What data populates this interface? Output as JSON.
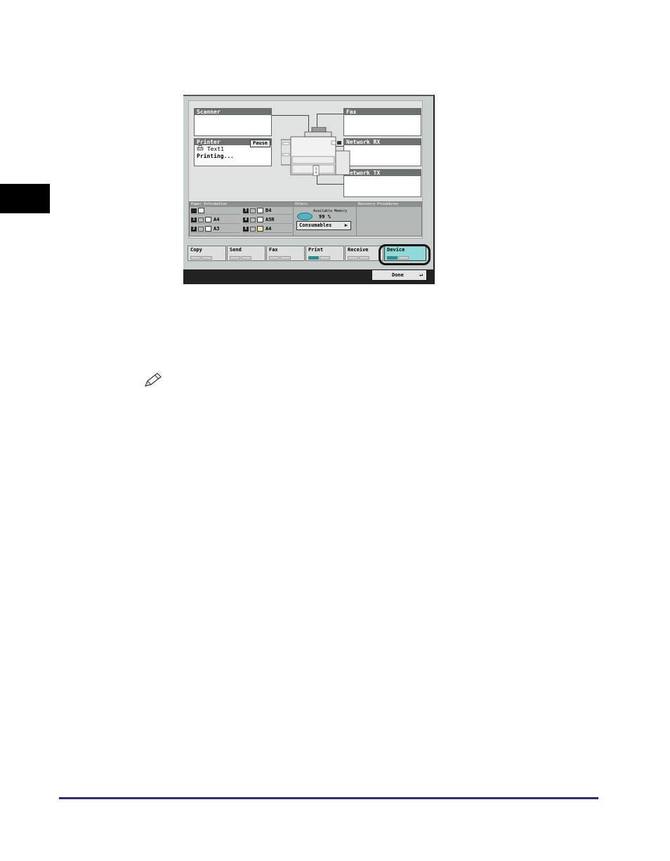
{
  "status_screen": {
    "panels": {
      "scanner": {
        "title": "Scanner"
      },
      "printer": {
        "title": "Printer",
        "pause_label": "Pause",
        "job_name": "Text1",
        "job_status": "Printing..."
      },
      "fax": {
        "title": "Fax"
      },
      "network_rx": {
        "title": "Network RX"
      },
      "network_tx": {
        "title": "Network TX"
      }
    },
    "paper_information": {
      "title": "Paper Information",
      "trays": [
        {
          "num": "",
          "size": ""
        },
        {
          "num": "3",
          "size": "B4"
        },
        {
          "num": "1",
          "size": "A4"
        },
        {
          "num": "4",
          "size": "A5R"
        },
        {
          "num": "2",
          "size": "A3"
        },
        {
          "num": "5",
          "size": "A4"
        }
      ]
    },
    "others": {
      "title": "Others",
      "memory_label": "Available Memory",
      "memory_value": "99 %",
      "consumables_label": "Consumables"
    },
    "recovery": {
      "title": "Recovery Procedures"
    },
    "tabs": {
      "copy": "Copy",
      "send": "Send",
      "fax": "Fax",
      "print": "Print",
      "receive": "Receive",
      "device": "Device"
    },
    "done_label": "Done"
  },
  "icons": [
    "printer-job-icon",
    "memory-disk-icon",
    "arrow-right-icon",
    "return-arrow-icon",
    "pencil-note-icon"
  ],
  "colors": {
    "active_tab": "#8fd9d9",
    "indicator": "#2d8e8f",
    "footer_rule": "#2e2a7b"
  }
}
